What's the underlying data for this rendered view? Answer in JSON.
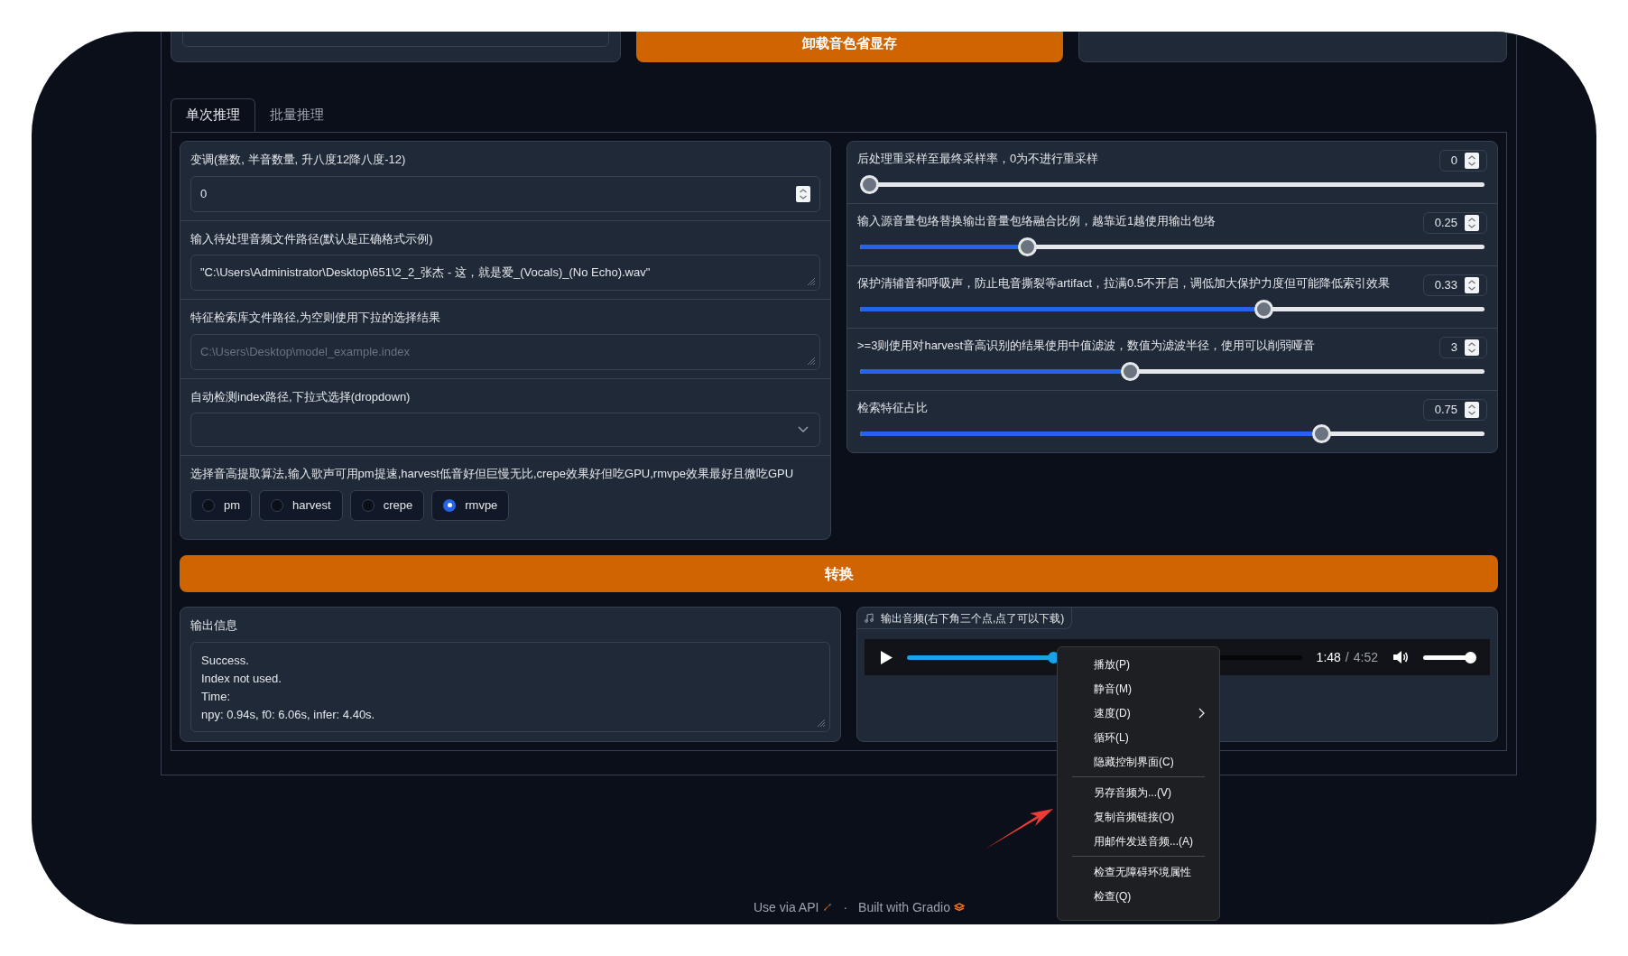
{
  "top_row": {
    "button": "卸载音色省显存"
  },
  "tabs": [
    {
      "label": "单次推理",
      "selected": true
    },
    {
      "label": "批量推理",
      "selected": false
    }
  ],
  "left_fields": [
    {
      "kind": "number",
      "label": "变调(整数, 半音数量, 升八度12降八度-12)",
      "value": "0"
    },
    {
      "kind": "textarea",
      "label": "输入待处理音频文件路径(默认是正确格式示例)",
      "value": "\"C:\\Users\\Administrator\\Desktop\\651\\2_2_张杰 - 这，就是爱_(Vocals)_(No Echo).wav\""
    },
    {
      "kind": "textarea",
      "label": "特征检索库文件路径,为空则使用下拉的选择结果",
      "placeholder": "C:\\Users\\Desktop\\model_example.index"
    },
    {
      "kind": "dropdown",
      "label": "自动检测index路径,下拉式选择(dropdown)"
    },
    {
      "kind": "radio",
      "label": "选择音高提取算法,输入歌声可用pm提速,harvest低音好但巨慢无比,crepe效果好但吃GPU,rmvpe效果最好且微吃GPU",
      "options": [
        {
          "label": "pm",
          "selected": false
        },
        {
          "label": "harvest",
          "selected": false
        },
        {
          "label": "crepe",
          "selected": false
        },
        {
          "label": "rmvpe",
          "selected": true
        }
      ]
    }
  ],
  "sliders": [
    {
      "label": "后处理重采样至最终采样率，0为不进行重采样",
      "value": "0",
      "level": 0
    },
    {
      "label": "输入源音量包络替换输出音量包络融合比例，越靠近1越使用输出包络",
      "value": "0.25",
      "level": 0.26
    },
    {
      "label": "保护清辅音和呼吸声，防止电音撕裂等artifact，拉满0.5不开启，调低加大保护力度但可能降低索引效果",
      "value": "0.33",
      "level": 0.65
    },
    {
      "label": ">=3则使用对harvest音高识别的结果使用中值滤波，数值为滤波半径，使用可以削弱哑音",
      "value": "3",
      "level": 0.43
    },
    {
      "label": "检索特征占比",
      "value": "0.75",
      "level": 0.745
    }
  ],
  "convert_button": "转换",
  "output_info": {
    "label": "输出信息",
    "value": "Success.\nIndex not used.\nTime:\nnpy: 0.94s, f0: 6.06s, infer: 4.40s."
  },
  "audio": {
    "label": "输出音频(右下角三个点,点了可以下载)",
    "current": "1:48",
    "separator": "/",
    "duration": "4:52",
    "level": 0.37,
    "volume": {
      "level": 0.92
    }
  },
  "context_menu": [
    {
      "kind": "item",
      "label": "播放(P)",
      "submenu": false
    },
    {
      "kind": "item",
      "label": "静音(M)",
      "submenu": false
    },
    {
      "kind": "item",
      "label": "速度(D)",
      "submenu": true
    },
    {
      "kind": "item",
      "label": "循环(L)",
      "submenu": false
    },
    {
      "kind": "item",
      "label": "隐藏控制界面(C)",
      "submenu": false
    },
    {
      "kind": "separator"
    },
    {
      "kind": "item",
      "label": "另存音频为...(V)",
      "submenu": false
    },
    {
      "kind": "item",
      "label": "复制音频链接(O)",
      "submenu": false
    },
    {
      "kind": "item",
      "label": "用邮件发送音频...(A)",
      "submenu": false
    },
    {
      "kind": "separator"
    },
    {
      "kind": "item",
      "label": "检查无障碍环境属性",
      "submenu": false
    },
    {
      "kind": "item",
      "label": "检查(Q)",
      "submenu": false
    }
  ],
  "footer": {
    "api": "Use via API",
    "separator": "·",
    "built": "Built with Gradio"
  }
}
